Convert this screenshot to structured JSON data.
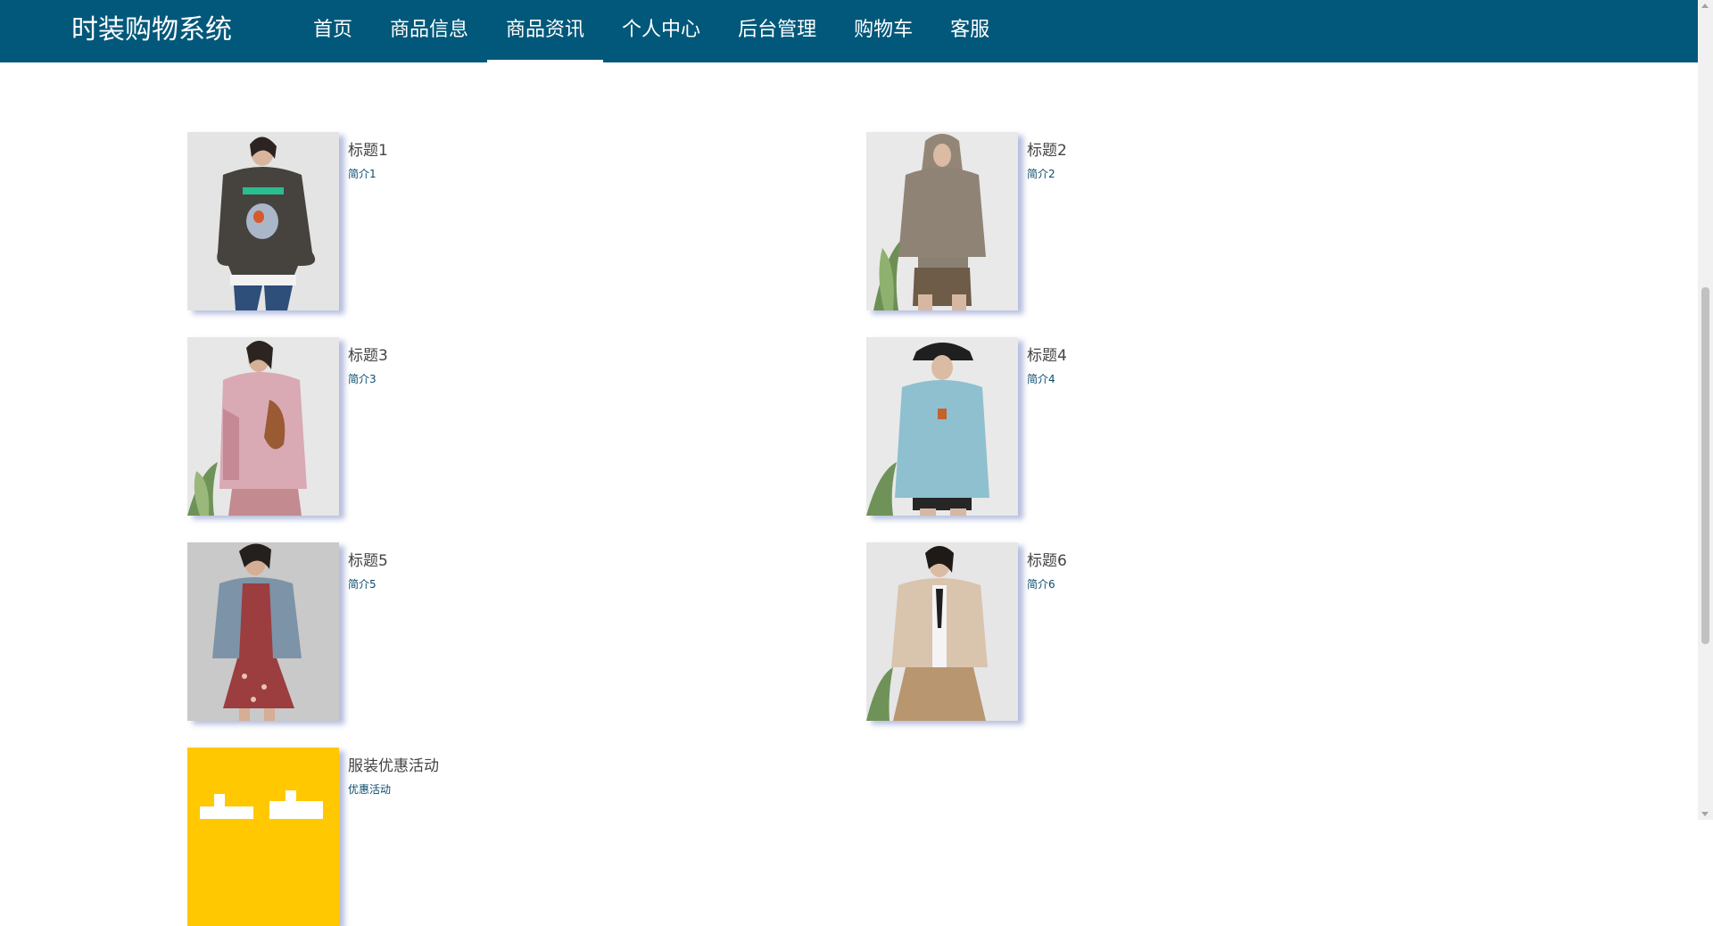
{
  "app": {
    "brand": "时装购物系统",
    "colors": {
      "header_bg": "#02587a",
      "intro_text": "#0b4d6e",
      "title_text": "#444444"
    }
  },
  "nav": {
    "items": [
      {
        "label": "首页"
      },
      {
        "label": "商品信息"
      },
      {
        "label": "商品资讯",
        "active": true
      },
      {
        "label": "个人中心"
      },
      {
        "label": "后台管理"
      },
      {
        "label": "购物车"
      },
      {
        "label": "客服"
      }
    ]
  },
  "news": {
    "items": [
      {
        "title": "标题1",
        "intro": "简介1",
        "image": "woman-dark-sweatshirt-photo"
      },
      {
        "title": "标题2",
        "intro": "简介2",
        "image": "woman-beige-hoodie-photo"
      },
      {
        "title": "标题3",
        "intro": "简介3",
        "image": "woman-pink-hoodie-photo"
      },
      {
        "title": "标题4",
        "intro": "简介4",
        "image": "woman-blue-hoodie-photo"
      },
      {
        "title": "标题5",
        "intro": "简介5",
        "image": "woman-denim-jacket-photo"
      },
      {
        "title": "标题6",
        "intro": "简介6",
        "image": "woman-fleece-jacket-photo"
      },
      {
        "title": "服装优惠活动",
        "intro": "优惠活动",
        "image": "promo-yellow-banner"
      }
    ]
  }
}
